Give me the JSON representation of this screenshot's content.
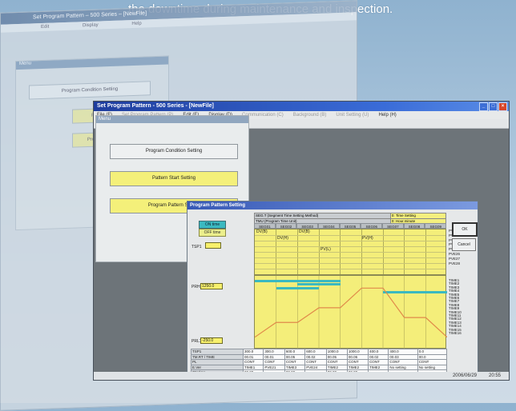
{
  "caption": "the downtime during maintenance and inspection.",
  "background_window": {
    "title": "Set Program Pattern – 500 Series – [NewFile]",
    "menu": "Edit  Display  Help",
    "panel_title": "Menu",
    "buttons": [
      "Program Condition Setting",
      "Pattern Start Setting",
      "Program Pattern Setting"
    ]
  },
  "window": {
    "title": "Set Program Pattern - 500 Series - [NewFile]",
    "menu": [
      "File (F)",
      "Set Program Pattern (P)",
      "Edit (E)",
      "Display (D)",
      "Communication (C)",
      "Background (B)",
      "Unit Setting (U)",
      "Help (H)"
    ],
    "toolbar": [
      "□",
      "▭",
      "▤",
      "▦",
      "✎",
      "↶",
      "?",
      "⌂"
    ],
    "status_date": "2006/06/29",
    "status_time": "20:55"
  },
  "menu_panel": {
    "title": "Menu",
    "btn_condition": "Program Condition Setting",
    "btn_start": "Pattern Start Setting",
    "btn_pattern": "Program Pattern Setting"
  },
  "dialog": {
    "title": "Program Pattern Setting",
    "on_label": "ON time",
    "off_label": "OFF time",
    "tsp_label": "TSP1",
    "prh_label": "PRH1",
    "prh_value": "1250.0",
    "prl_label": "PRL1",
    "prl_value": "-250.0",
    "ok": "OK",
    "cancel": "Cancel",
    "head_rows": [
      {
        "label": "SEG.T (Segment Time Setting Method)",
        "value": "0: Time Setting"
      },
      {
        "label": "TMU (Program Time Unit)",
        "value": "0: Hour.minute"
      }
    ],
    "segments": [
      "SEG01",
      "SEG02",
      "SEG03",
      "SEG04",
      "SEG05",
      "SEG06",
      "SEG07",
      "SEG08",
      "SEG09"
    ],
    "events": [
      "DV(B)",
      "DV(B)",
      "DV(H)",
      "PV(H)",
      "PV(L)"
    ],
    "pv_events": [
      "PVE21",
      "PVE22",
      "PVE23",
      "PVE24",
      "PVE25",
      "PVE26",
      "PVE27",
      "PVE28"
    ],
    "time_events": [
      "TIME1",
      "TIME2",
      "TIME3",
      "TIME4",
      "TIME5",
      "TIME6",
      "TIME7",
      "TIME8",
      "TIME9",
      "TIME10",
      "TIME11",
      "TIME12",
      "TIME13",
      "TIME14",
      "TIME15",
      "TIME16"
    ],
    "table": {
      "row_labels": [
        "TSP1",
        "TM.RT / TIME",
        "PL",
        "E.Ver",
        "ON time"
      ],
      "rows": [
        [
          "300.0",
          "300.0",
          "600.0",
          "600.0",
          "1000.0",
          "1000.0",
          "400.0",
          "400.0",
          "0.0"
        ],
        [
          "00.01",
          "00.01",
          "00.05",
          "00.02",
          "00.05",
          "00.06",
          "00.02",
          "00.03",
          "00.0"
        ],
        [
          "CONT",
          "CONT",
          "CONT",
          "CONT",
          "CONT",
          "CONT",
          "CONT",
          "CONT",
          "CONT"
        ],
        [
          "TIME1",
          "PVE21",
          "TIME3",
          "PVE24",
          "TIME2",
          "TIME2",
          "TIME2",
          "No setting",
          "No setting"
        ],
        [
          "00.00",
          "",
          "00.00",
          "",
          "00.00",
          "00.00",
          "---",
          "",
          ""
        ]
      ]
    },
    "program_line_values": [
      300.0,
      300.0,
      600.0,
      600.0,
      1000.0,
      1000.0,
      400.0,
      400.0,
      0.0
    ],
    "program_line_range": [
      -250.0,
      1250.0
    ],
    "colors": {
      "accent_cyan": "#3bb9c0",
      "yellow": "#f4ee7a",
      "line": "#e08a4a"
    }
  }
}
